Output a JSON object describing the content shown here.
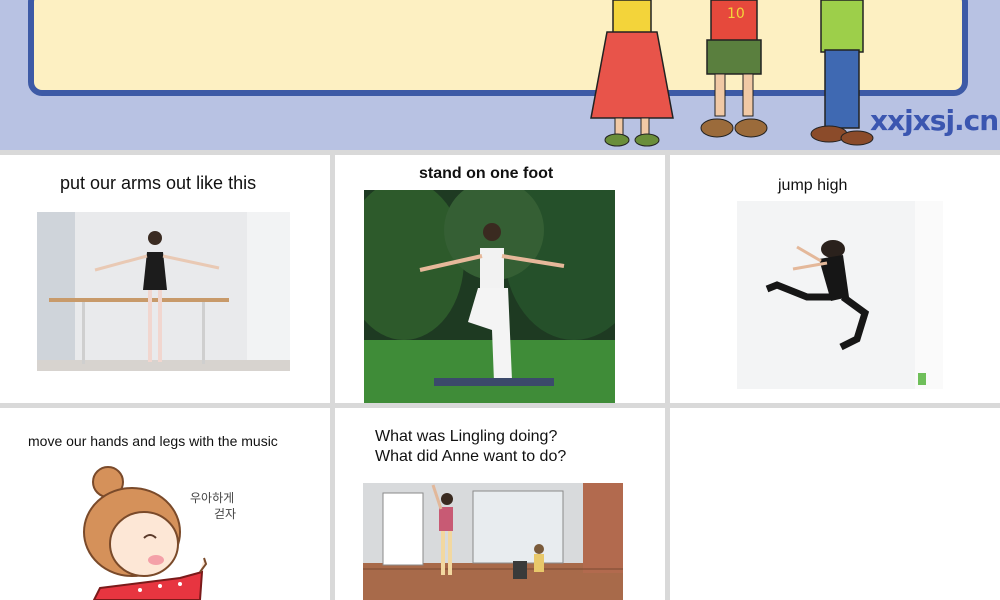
{
  "banner": {
    "watermark": "xxjxsj.cn"
  },
  "cards": [
    {
      "caption": "put our arms out like this"
    },
    {
      "caption": "stand on one foot"
    },
    {
      "caption": "jump high"
    },
    {
      "caption": "move our hands and legs with the music"
    },
    {
      "question_1": "What was Lingling doing?",
      "question_2": "What did Anne want to do?"
    }
  ],
  "cartoon_text": {
    "line1": "우아하게",
    "line2": "걷자"
  }
}
